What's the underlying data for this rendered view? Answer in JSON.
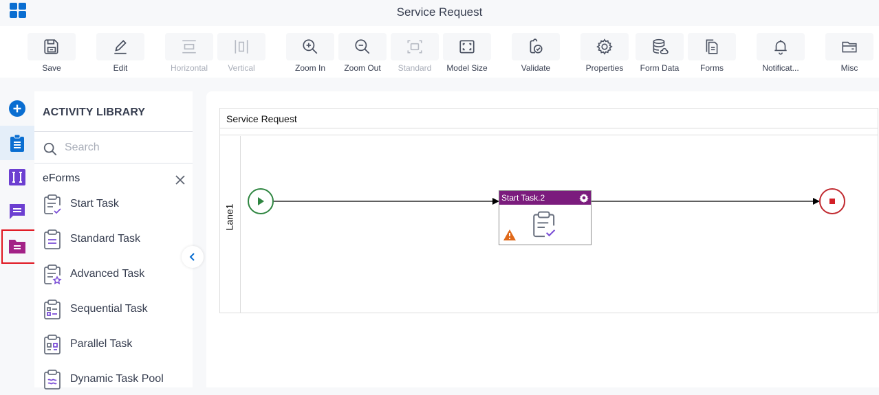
{
  "window": {
    "title": "Service Request"
  },
  "toolbar": {
    "buttons": [
      {
        "label": "Save",
        "icon": "save-icon",
        "disabled": false
      },
      {
        "label": "Edit",
        "icon": "pencil-icon",
        "disabled": false
      },
      {
        "label": "Horizontal",
        "icon": "horizontal-layout-icon",
        "disabled": true
      },
      {
        "label": "Vertical",
        "icon": "vertical-layout-icon",
        "disabled": true
      },
      {
        "label": "Zoom In",
        "icon": "zoom-in-icon",
        "disabled": false
      },
      {
        "label": "Zoom Out",
        "icon": "zoom-out-icon",
        "disabled": false
      },
      {
        "label": "Standard",
        "icon": "standard-size-icon",
        "disabled": true
      },
      {
        "label": "Model Size",
        "icon": "model-size-icon",
        "disabled": false
      },
      {
        "label": "Validate",
        "icon": "validate-icon",
        "disabled": false
      },
      {
        "label": "Properties",
        "icon": "gear-icon",
        "disabled": false
      },
      {
        "label": "Form Data",
        "icon": "database-icon",
        "disabled": false
      },
      {
        "label": "Forms",
        "icon": "forms-icon",
        "disabled": false
      },
      {
        "label": "Notificat...",
        "icon": "bell-icon",
        "disabled": false
      },
      {
        "label": "Misc",
        "icon": "folder-icon",
        "disabled": false
      }
    ]
  },
  "left_rail": {
    "items": [
      {
        "name": "add",
        "icon": "plus-circle-icon",
        "color": "#0a6ed1"
      },
      {
        "name": "activities",
        "icon": "clipboard-icon",
        "color": "#0a6ed1",
        "active": true
      },
      {
        "name": "integration",
        "icon": "integration-icon",
        "color": "#6c3fd1"
      },
      {
        "name": "messages",
        "icon": "chat-icon",
        "color": "#6c3fd1"
      },
      {
        "name": "eforms",
        "icon": "folder-doc-icon",
        "color": "#a32287",
        "selected": true
      }
    ]
  },
  "library": {
    "title": "ACTIVITY LIBRARY",
    "search_placeholder": "Search",
    "category": "eForms",
    "items": [
      {
        "label": "Start Task",
        "icon": "start-task-icon"
      },
      {
        "label": "Standard Task",
        "icon": "standard-task-icon"
      },
      {
        "label": "Advanced Task",
        "icon": "advanced-task-icon"
      },
      {
        "label": "Sequential Task",
        "icon": "sequential-task-icon"
      },
      {
        "label": "Parallel Task",
        "icon": "parallel-task-icon"
      },
      {
        "label": "Dynamic Task Pool",
        "icon": "dynamic-task-pool-icon"
      }
    ]
  },
  "canvas": {
    "pool_title": "Service Request",
    "lane_label": "Lane1",
    "task": {
      "name": "Start Task.2",
      "header_color": "#7b1c7d",
      "has_warning": true
    },
    "start_event_color": "#2e8540",
    "end_event_color": "#c0292f"
  }
}
